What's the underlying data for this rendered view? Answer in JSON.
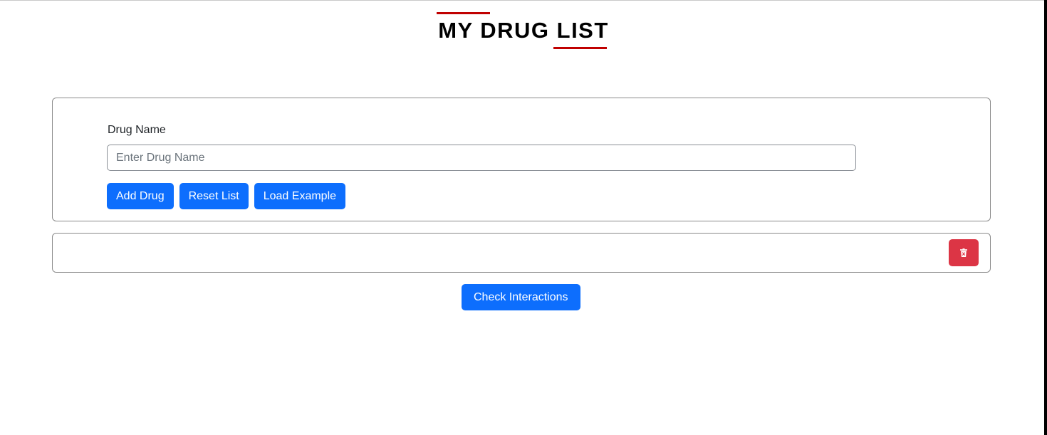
{
  "header": {
    "title": "MY DRUG LIST"
  },
  "form": {
    "label": "Drug Name",
    "input_value": "",
    "input_placeholder": "Enter Drug Name",
    "buttons": {
      "add": "Add Drug",
      "reset": "Reset List",
      "load_example": "Load Example"
    }
  },
  "drug_list": {
    "items": [],
    "delete_icon": "trash-icon"
  },
  "actions": {
    "check_interactions": "Check Interactions"
  },
  "colors": {
    "primary": "#0d6efd",
    "danger": "#dc3545",
    "accent_red": "#c00000"
  }
}
